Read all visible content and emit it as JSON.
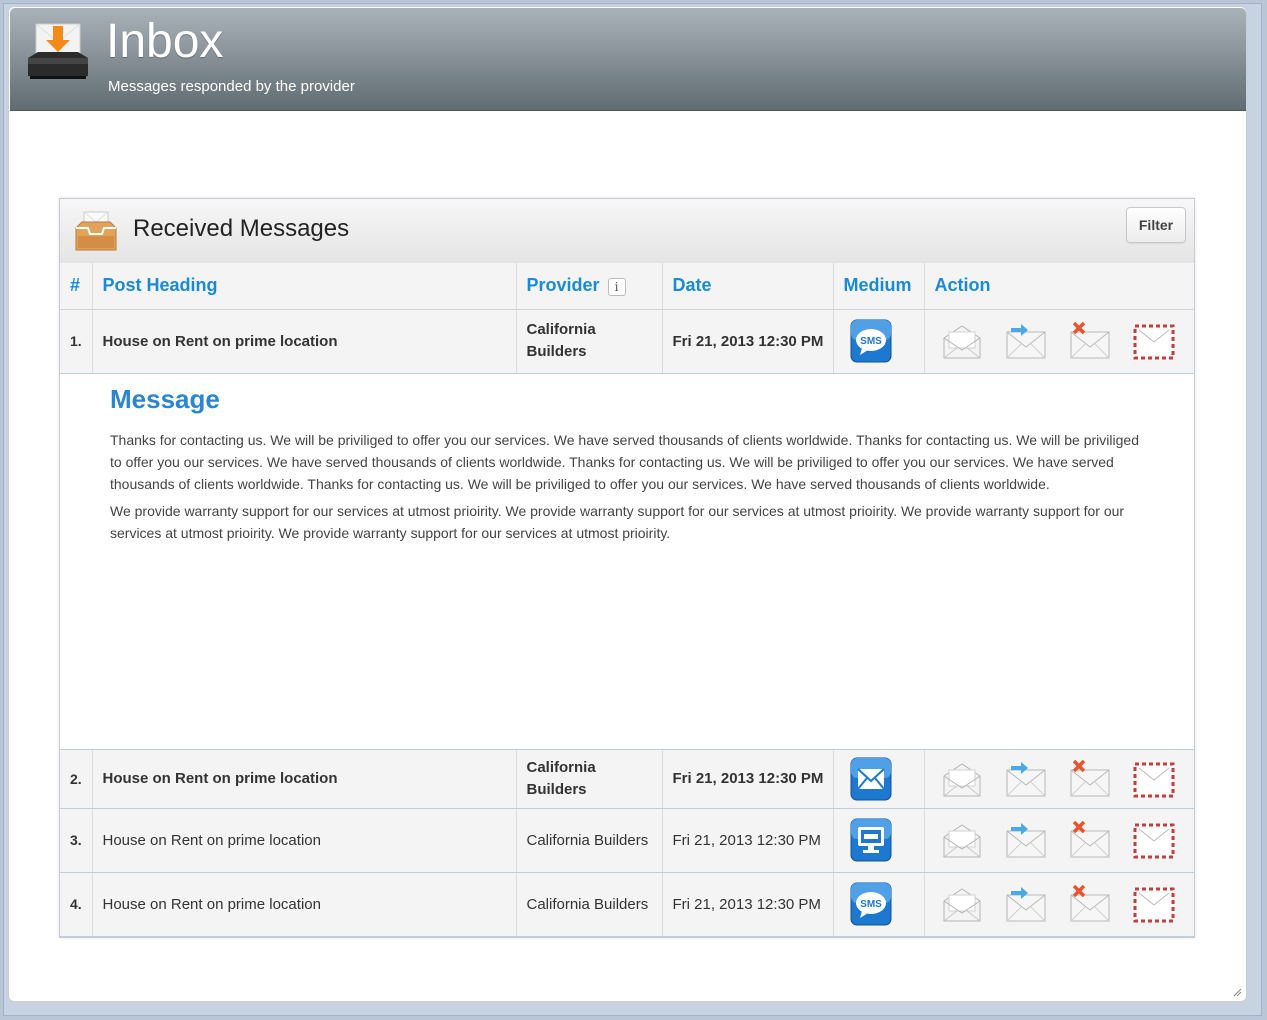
{
  "header": {
    "title": "Inbox",
    "subtitle": "Messages responded by the provider",
    "icon": "inbox-download-icon"
  },
  "panel": {
    "title": "Received Messages",
    "icon": "inbox-tray-icon",
    "filter_label": "Filter"
  },
  "table": {
    "columns": {
      "num": "#",
      "heading": "Post Heading",
      "provider": "Provider",
      "provider_info": "i",
      "date": "Date",
      "medium": "Medium",
      "action": "Action"
    },
    "rows": [
      {
        "num": "1.",
        "heading": "House on Rent on prime location",
        "provider": "California Builders",
        "date": "Fri 21, 2013 12:30 PM",
        "medium": "sms-icon",
        "unread": true
      },
      {
        "num": "2.",
        "heading": "House on Rent on prime location",
        "provider": "California Builders",
        "date": "Fri 21, 2013 12:30 PM",
        "medium": "email-icon",
        "unread": true
      },
      {
        "num": "3.",
        "heading": "House on Rent on prime location",
        "provider": "California Builders",
        "date": "Fri 21, 2013 12:30 PM",
        "medium": "web-icon",
        "unread": false
      },
      {
        "num": "4.",
        "heading": "House on Rent on prime location",
        "provider": "California Builders",
        "date": "Fri 21, 2013 12:30 PM",
        "medium": "sms-icon",
        "unread": false
      }
    ],
    "actions": [
      "open-mail-icon",
      "forward-mail-icon",
      "delete-mail-icon",
      "airmail-icon"
    ]
  },
  "message": {
    "title": "Message",
    "paragraph1": "Thanks for contacting us. We will be priviliged to offer you our services. We have served thousands of clients worldwide. Thanks for contacting us. We will be priviliged to offer you our services. We have served thousands of clients worldwide. Thanks for contacting us. We will be priviliged to offer you our services. We have served thousands of clients worldwide. Thanks for contacting us. We will be priviliged to offer you our services. We have served thousands of clients worldwide.",
    "paragraph2": "We provide warranty support for our services at utmost prioirity. We provide warranty support for our services at utmost prioirity. We provide warranty support for our services at utmost prioirity. We provide warranty support for our services at utmost prioirity."
  },
  "colors": {
    "accent": "#1a8ad4",
    "header_top": "#a8b2b8",
    "header_bottom": "#606b72",
    "sms_blue": "#1d78d0"
  }
}
